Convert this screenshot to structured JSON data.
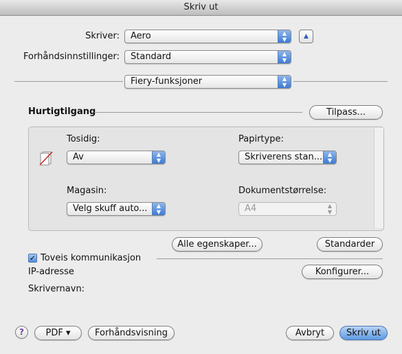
{
  "window": {
    "title": "Skriv ut"
  },
  "printer": {
    "label": "Skriver:",
    "value": "Aero"
  },
  "presets": {
    "label": "Forhåndsinnstillinger:",
    "value": "Standard"
  },
  "panel_selector": {
    "value": "Fiery-funksjoner"
  },
  "quick_access": {
    "title": "Hurtigtilgang",
    "customize_label": "Tilpass...",
    "duplex": {
      "label": "Tosidig:",
      "value": "Av"
    },
    "paper_type": {
      "label": "Papirtype:",
      "value": "Skriverens stan..."
    },
    "tray": {
      "label": "Magasin:",
      "value": "Velg skuff auto..."
    },
    "doc_size": {
      "label": "Dokumentstørrelse:",
      "value": "A4"
    }
  },
  "buttons": {
    "all_properties": "Alle egenskaper...",
    "defaults": "Standarder",
    "configure": "Konfigurer...",
    "pdf": "PDF ▾",
    "preview": "Forhåndsvisning",
    "cancel": "Avbryt",
    "print": "Skriv ut",
    "help": "?"
  },
  "two_way": {
    "label": "Toveis kommunikasjon",
    "checked": true
  },
  "ip_address": {
    "label": "IP-adresse"
  },
  "printer_name": {
    "label": "Skrivernavn:"
  },
  "icons": {
    "duplex_off": "duplex-off-icon",
    "collapse": "triangle-up-icon"
  }
}
